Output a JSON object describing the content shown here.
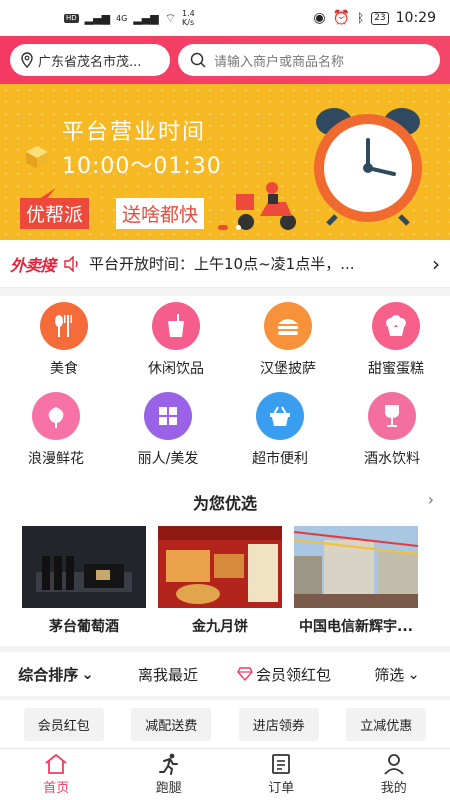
{
  "status_bar": {
    "network_left": "4G",
    "speed_value": "1.4",
    "speed_unit": "K/s",
    "battery": "23",
    "time": "10:29"
  },
  "header": {
    "location": "广东省茂名市茂...",
    "search_placeholder": "请输入商户或商品名称"
  },
  "banner": {
    "title": "平台营业时间",
    "time": "10:00～01:30",
    "tag1": "优帮派",
    "tag2": "送啥都快"
  },
  "notice": {
    "logo": "外卖接",
    "text": "平台开放时间：上午10点~凌1点半，..."
  },
  "categories": [
    {
      "label": "美食",
      "icon": "fork-knife-icon",
      "color": "#f56c3a"
    },
    {
      "label": "休闲饮品",
      "icon": "drink-cup-icon",
      "color": "#f45d8c"
    },
    {
      "label": "汉堡披萨",
      "icon": "burger-icon",
      "color": "#f7923a"
    },
    {
      "label": "甜蜜蛋糕",
      "icon": "cake-icon",
      "color": "#f6608a"
    },
    {
      "label": "浪漫鲜花",
      "icon": "flower-icon",
      "color": "#f772a4"
    },
    {
      "label": "丽人/美发",
      "icon": "grid-icon",
      "color": "#9a62e6"
    },
    {
      "label": "超市便利",
      "icon": "basket-icon",
      "color": "#3a9ef0"
    },
    {
      "label": "酒水饮料",
      "icon": "wine-glass-icon",
      "color": "#f3709e"
    }
  ],
  "recommended": {
    "title": "为您优选",
    "items": [
      {
        "name": "茅台葡萄酒"
      },
      {
        "name": "金九月饼"
      },
      {
        "name": "中国电信新辉宇..."
      }
    ]
  },
  "sort_bar": {
    "general": "综合排序",
    "nearest": "离我最近",
    "member_red_packet": "会员领红包",
    "filter": "筛选"
  },
  "chips": [
    "会员红包",
    "减配送费",
    "进店领券",
    "立减优惠"
  ],
  "tabs": [
    {
      "label": "首页",
      "icon": "home-icon",
      "active": true
    },
    {
      "label": "跑腿",
      "icon": "runner-icon",
      "active": false
    },
    {
      "label": "订单",
      "icon": "order-list-icon",
      "active": false
    },
    {
      "label": "我的",
      "icon": "user-icon",
      "active": false
    }
  ],
  "colors": {
    "brand": "#f43a62",
    "banner": "#f6b923",
    "accent_red": "#ee4a3c"
  }
}
